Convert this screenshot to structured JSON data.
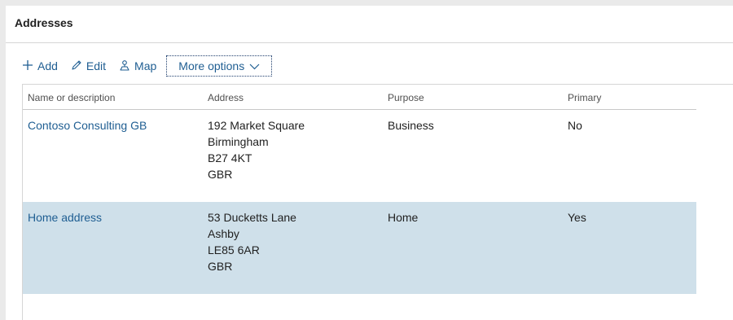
{
  "panel": {
    "title": "Addresses"
  },
  "toolbar": {
    "add_label": "Add",
    "edit_label": "Edit",
    "map_label": "Map",
    "more_label": "More options"
  },
  "grid": {
    "columns": [
      "Name or description",
      "Address",
      "Purpose",
      "Primary"
    ],
    "rows": [
      {
        "name": "Contoso Consulting GB",
        "address": [
          "192 Market Square",
          "Birmingham",
          "B27 4KT",
          "GBR"
        ],
        "purpose": "Business",
        "primary": "No",
        "selected": false
      },
      {
        "name": "Home address",
        "address": [
          "53 Ducketts Lane",
          "Ashby",
          "LE85 6AR",
          "GBR"
        ],
        "purpose": "Home",
        "primary": "Yes",
        "selected": true
      }
    ]
  },
  "colors": {
    "link": "#1f5e92",
    "selected_row": "#cfe0ea",
    "border": "#d6d6d6"
  }
}
